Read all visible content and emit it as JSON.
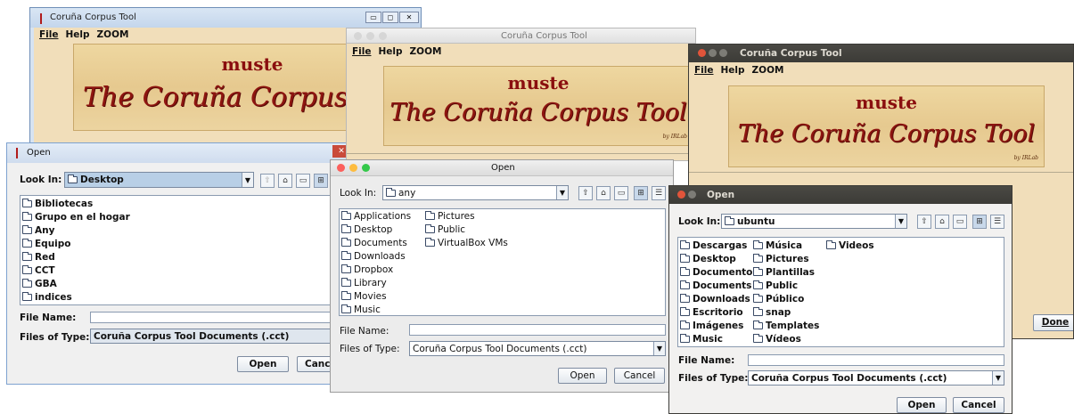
{
  "app_title": "Coruña Corpus Tool",
  "menu": [
    "File",
    "Help",
    "ZOOM"
  ],
  "banner": {
    "muste": "muste",
    "title": "The Coruña Corpus Tool",
    "byline": "by IRLab"
  },
  "dialog_title": "Open",
  "labels": {
    "look_in": "Look In:",
    "file_name": "File Name:",
    "files_of_type": "Files of Type:",
    "file_type_value": "Coruña Corpus Tool Documents (.cct)"
  },
  "buttons": {
    "open": "Open",
    "cancel": "Cancel",
    "cancel_truncated": "Cance",
    "done": "Done"
  },
  "windows_dialog": {
    "look_in_value": "Desktop",
    "items": [
      "Bibliotecas",
      "Grupo en el hogar",
      "Any",
      "Equipo",
      "Red",
      "CCT",
      "GBA",
      "indices"
    ]
  },
  "mac_dialog": {
    "look_in_value": "any",
    "col1": [
      "Applications",
      "Desktop",
      "Documents",
      "Downloads",
      "Dropbox",
      "Library",
      "Movies",
      "Music"
    ],
    "col2": [
      "Pictures",
      "Public",
      "VirtualBox VMs"
    ]
  },
  "ubuntu_dialog": {
    "look_in_value": "ubuntu",
    "col1": [
      "Descargas",
      "Desktop",
      "Documentos",
      "Documents",
      "Downloads",
      "Escritorio",
      "Imágenes",
      "Music"
    ],
    "col2": [
      "Música",
      "Pictures",
      "Plantillas",
      "Public",
      "Público",
      "snap",
      "Templates",
      "Vídeos"
    ],
    "col3": [
      "Videos"
    ]
  },
  "colors": {
    "banner_bg": "#e6c98f",
    "frame_bg": "#f1deba",
    "title_red": "#8e1510",
    "ubuntu_titlebar": "#3c3b37",
    "ubuntu_close": "#e1543a",
    "windows_border": "#7ea2d0",
    "selection_blue": "#b8cfe6"
  }
}
